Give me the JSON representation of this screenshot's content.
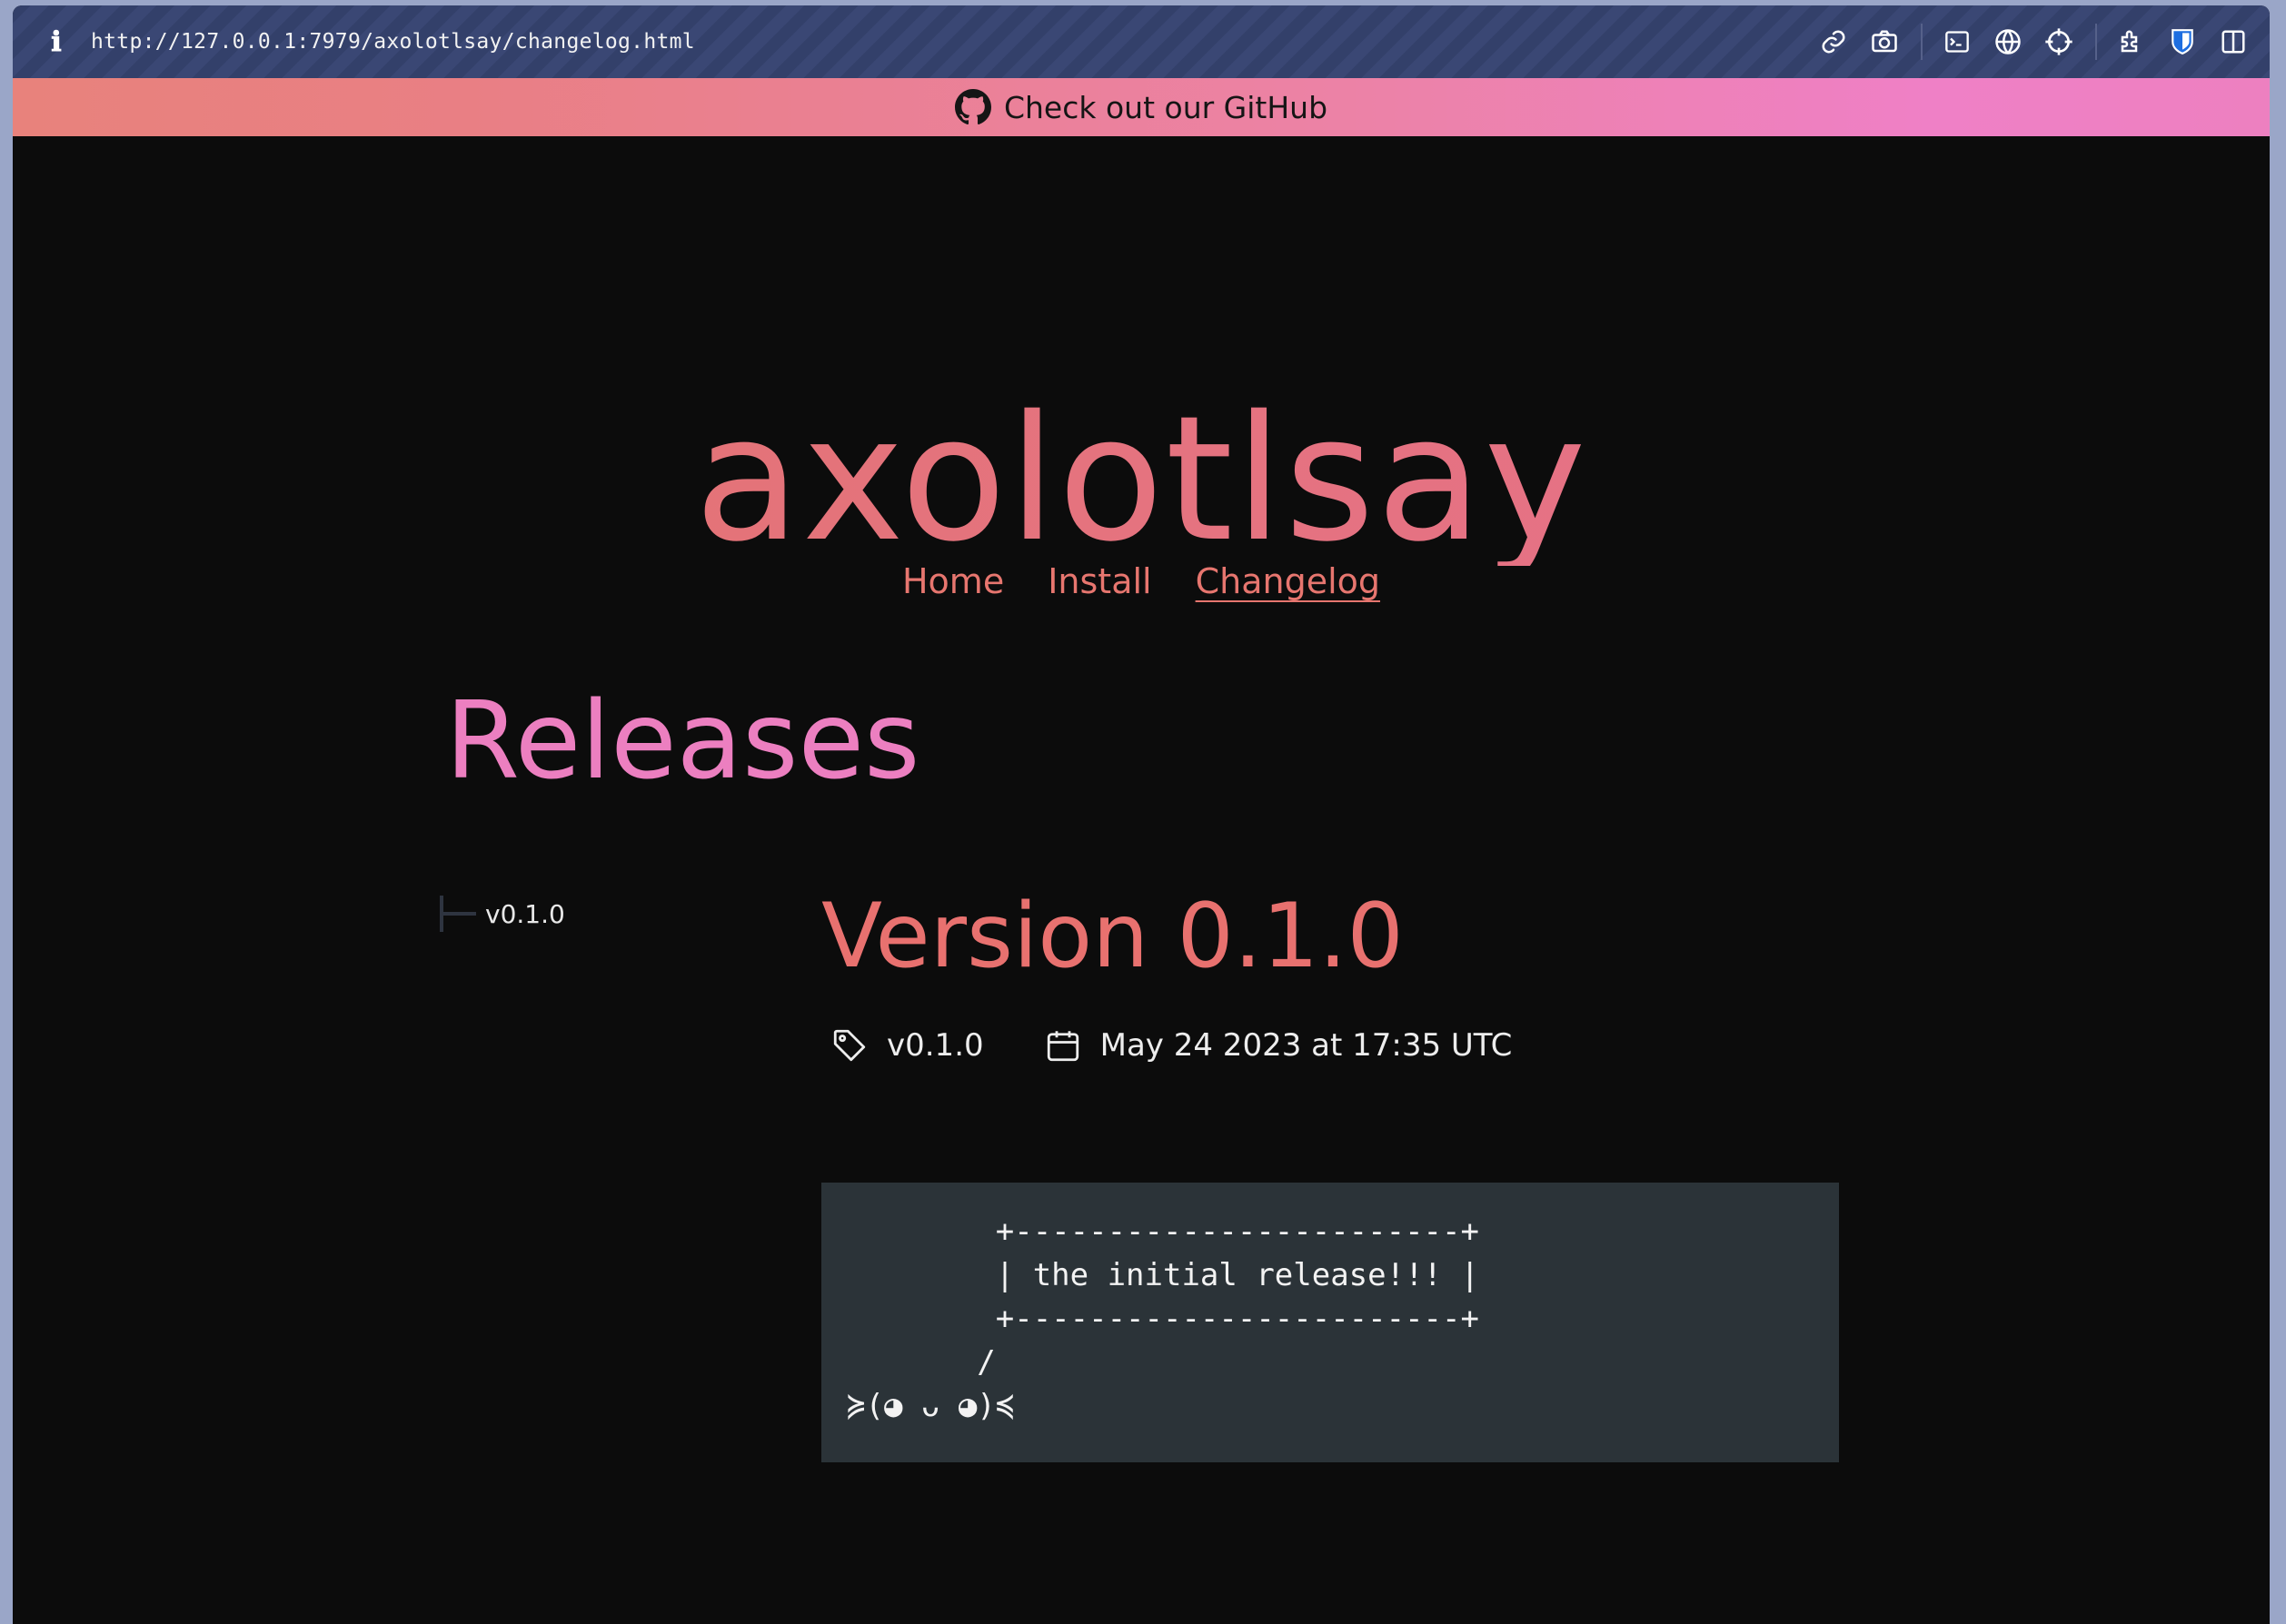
{
  "browser": {
    "url": "http://127.0.0.1:7979/axolotlsay/changelog.html",
    "info_icon": "ℹ",
    "toolbar_icons": [
      "link-icon",
      "camera-icon",
      "terminal-icon",
      "globe-icon",
      "crosshair-icon",
      "extensions-icon",
      "bitwarden-icon",
      "sidebar-icon"
    ]
  },
  "banner": {
    "text": "Check out our GitHub",
    "icon": "github-icon"
  },
  "site": {
    "title": "axolotlsay",
    "nav": [
      {
        "label": "Home"
      },
      {
        "label": "Install"
      },
      {
        "label": "Changelog"
      }
    ]
  },
  "page": {
    "heading": "Releases",
    "sidebar": {
      "items": [
        {
          "label": "v0.1.0"
        }
      ]
    },
    "release": {
      "title": "Version 0.1.0",
      "tag": "v0.1.0",
      "date": "May 24 2023 at 17:35 UTC",
      "body": "        +------------------------+\n        | the initial release!!! |\n        +------------------------+\n       /\n≽(◕ ᴗ ◕)≼"
    }
  },
  "colors": {
    "accent": "#e8716f",
    "heading_pink": "#ec7fc0",
    "background": "#0c0c0c",
    "code_bg": "#2b3338"
  }
}
